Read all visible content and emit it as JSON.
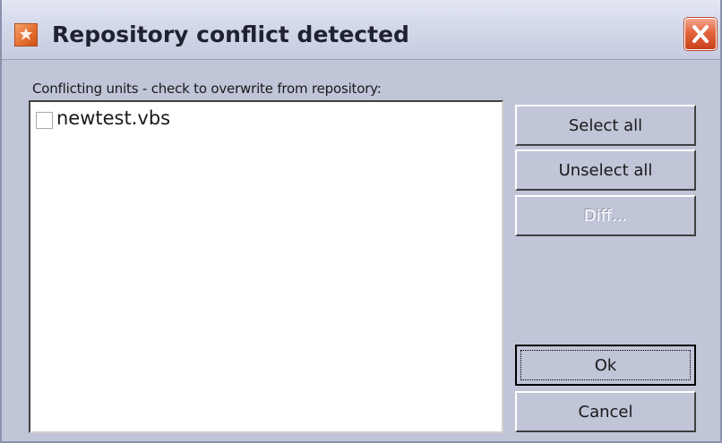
{
  "window": {
    "title": "Repository conflict detected",
    "colors": {
      "face": "#c0c5d8",
      "title_text": "#1f2233",
      "close_button": "#e3653e",
      "app_icon": "#e26b2d"
    },
    "icons": {
      "app": "repository-app-icon",
      "close": "close-icon"
    }
  },
  "prompt": "Conflicting units - check to overwrite from repository:",
  "units": [
    {
      "label": "newtest.vbs",
      "checked": false
    }
  ],
  "buttons": {
    "select_all": "Select all",
    "unselect_all": "Unselect all",
    "diff": "Diff...",
    "ok": "Ok",
    "cancel": "Cancel"
  }
}
